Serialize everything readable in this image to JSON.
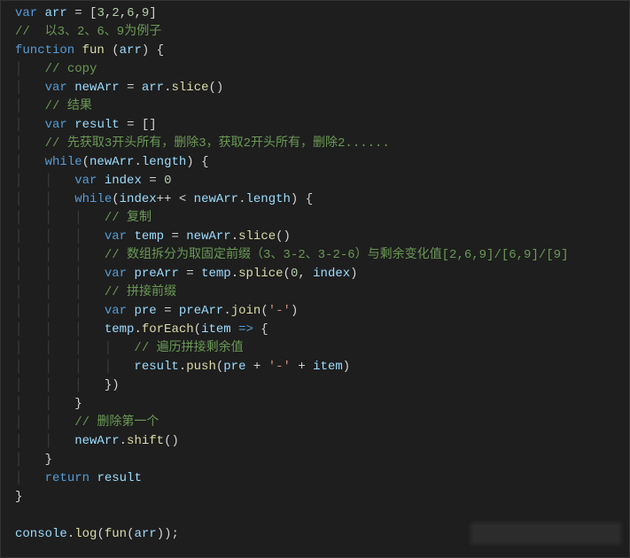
{
  "code": {
    "l1_var": "var",
    "l1_arr": "arr",
    "l1_vals": [
      "3",
      "2",
      "6",
      "9"
    ],
    "l2_com": "//  以3、2、6、9为例子",
    "l3_function": "function",
    "l3_fun": "fun",
    "l3_arr": "arr",
    "l4_com": "// copy",
    "l5_var": "var",
    "l5_newArr": "newArr",
    "l5_arr": "arr",
    "l5_slice": "slice",
    "l6_com": "// 结果",
    "l7_var": "var",
    "l7_result": "result",
    "l8_com": "// 先获取3开头所有，删除3，获取2开头所有，删除2......",
    "l9_while": "while",
    "l9_newArr": "newArr",
    "l9_length": "length",
    "l10_var": "var",
    "l10_index": "index",
    "l10_zero": "0",
    "l11_while": "while",
    "l11_index": "index",
    "l11_newArr": "newArr",
    "l11_length": "length",
    "l12_com": "// 复制",
    "l13_var": "var",
    "l13_temp": "temp",
    "l13_newArr": "newArr",
    "l13_slice": "slice",
    "l14_com": "// 数组拆分为取固定前缀（3、3-2、3-2-6）与剩余变化值[2,6,9]/[6,9]/[9]",
    "l15_var": "var",
    "l15_preArr": "preArr",
    "l15_temp": "temp",
    "l15_splice": "splice",
    "l15_zero": "0",
    "l15_index": "index",
    "l16_com": "// 拼接前缀",
    "l17_var": "var",
    "l17_pre": "pre",
    "l17_preArr": "preArr",
    "l17_join": "join",
    "l17_dash": "'-'",
    "l18_temp": "temp",
    "l18_forEach": "forEach",
    "l18_item": "item",
    "l19_com": "// 遍历拼接剩余值",
    "l20_result": "result",
    "l20_push": "push",
    "l20_pre": "pre",
    "l20_dash": "'-'",
    "l20_item": "item",
    "l23_com": "// 删除第一个",
    "l24_newArr": "newArr",
    "l24_shift": "shift",
    "l26_return": "return",
    "l26_result": "result",
    "l29_console": "console",
    "l29_log": "log",
    "l29_fun": "fun",
    "l29_arr": "arr"
  }
}
